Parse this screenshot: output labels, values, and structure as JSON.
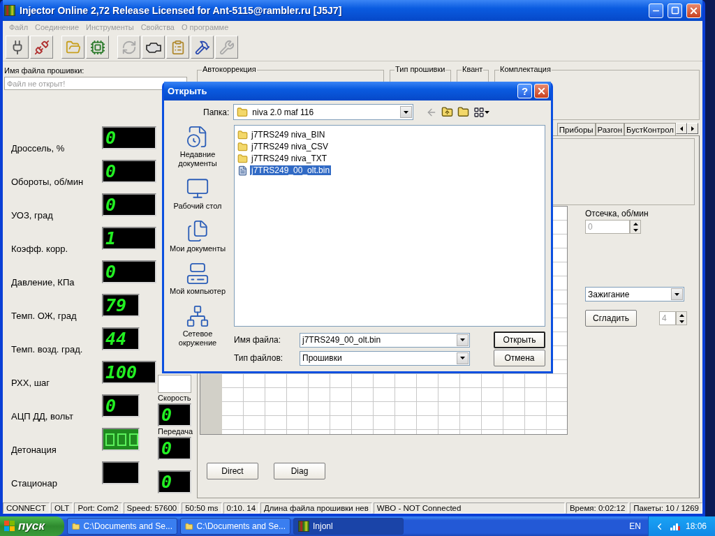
{
  "window": {
    "title": "Injector Online 2,72 Release  Licensed for Ant-5115@rambler.ru [J5J7]"
  },
  "menu": [
    {
      "label": "Файл",
      "disabled": true
    },
    {
      "label": "Соединение",
      "disabled": true
    },
    {
      "label": "Инструменты",
      "disabled": true
    },
    {
      "label": "Свойства",
      "disabled": true
    },
    {
      "label": "О программе",
      "disabled": true
    }
  ],
  "toolbar": [
    {
      "disabled": false
    },
    {
      "disabled": false
    },
    {
      "disabled": false
    },
    {
      "disabled": false
    },
    {
      "disabled": true
    },
    {
      "disabled": false
    },
    {
      "disabled": false
    },
    {
      "disabled": false
    },
    {
      "disabled": true
    }
  ],
  "firmware": {
    "label": "Имя файла прошивки:",
    "placeholder": "Файл не открыт!"
  },
  "gauges": [
    {
      "label": "Дроссель, %",
      "value": "0",
      "kind": "wide"
    },
    {
      "label": "Обороты, об/мин",
      "value": "0",
      "kind": "wide"
    },
    {
      "label": "УОЗ, град",
      "value": "0",
      "kind": "wide"
    },
    {
      "label": "Коэфф. корр.",
      "value": "1",
      "kind": "wide"
    },
    {
      "label": "Давление, КПа",
      "value": "0",
      "kind": "wide"
    },
    {
      "label": "Темп. ОЖ, град",
      "value": "79",
      "kind": "narrow"
    },
    {
      "label": "Темп. возд. град.",
      "value": "44",
      "kind": "narrow"
    },
    {
      "label": "РХХ, шаг",
      "value": "100",
      "kind": "wide"
    },
    {
      "label": "АЦП ДД, вольт",
      "value": "0",
      "kind": "narrow"
    },
    {
      "label": "Детонация",
      "kind": "lamp"
    },
    {
      "label": "Стационар",
      "kind": "narrow"
    }
  ],
  "side_gauges": [
    {
      "label": "Скорость",
      "value": "0"
    },
    {
      "label": "Передача",
      "value": "0"
    },
    {
      "value": "0"
    }
  ],
  "groups": [
    {
      "title": "Автокоррекция"
    },
    {
      "title": "Тип прошивки"
    },
    {
      "title": "Квант"
    },
    {
      "title": "Комплектация"
    }
  ],
  "tabs": [
    {
      "label": "Приборы",
      "selected": false
    },
    {
      "label": "Разгон",
      "selected": false
    },
    {
      "label": "БустКонтрол",
      "selected": false
    }
  ],
  "cutoff": {
    "label": "Отсечка, об/мин",
    "value": "0",
    "disabled": true
  },
  "map_select": {
    "value": "Зажигание"
  },
  "smooth_button": "Сгладить",
  "smooth_steps": {
    "value": "4",
    "disabled": true
  },
  "bottom_buttons": [
    "Direct",
    "Diag"
  ],
  "status_bar": [
    "CONNECT",
    "OLT",
    "Port: Com2",
    "Speed: 57600",
    "50:50 ms",
    "0:10. 14",
    "Длина файла прошивки нев",
    "WBO - NOT Connected",
    "Время: 0:02:12",
    "Пакеты: 10 / 1269"
  ],
  "dialog": {
    "title": "Открыть",
    "help": "?",
    "folder_label": "Папка:",
    "folder": "niva 2.0 maf 116",
    "places": [
      "Недавние документы",
      "Рабочий стол",
      "Мои документы",
      "Мой компьютер",
      "Сетевое окружение"
    ],
    "files": [
      {
        "name": "j7TRS249 niva_BIN",
        "kind": "folder",
        "selected": false
      },
      {
        "name": "j7TRS249 niva_CSV",
        "kind": "folder",
        "selected": false
      },
      {
        "name": "j7TRS249 niva_TXT",
        "kind": "folder",
        "selected": false
      },
      {
        "name": "j7TRS249_00_olt.bin",
        "kind": "file",
        "selected": true
      }
    ],
    "filename_label": "Имя файла:",
    "filename": "j7TRS249_00_olt.bin",
    "filetype_label": "Тип файлов:",
    "filetype": "Прошивки",
    "buttons": [
      "Открыть",
      "Отмена"
    ]
  },
  "taskbar": {
    "start": "пуск",
    "tasks": [
      {
        "label": "C:\\Documents and Se...",
        "selected": false
      },
      {
        "label": "C:\\Documents and Se...",
        "selected": false
      },
      {
        "label": "Injonl",
        "selected": true
      }
    ],
    "language": "EN",
    "clock": "18:06"
  }
}
